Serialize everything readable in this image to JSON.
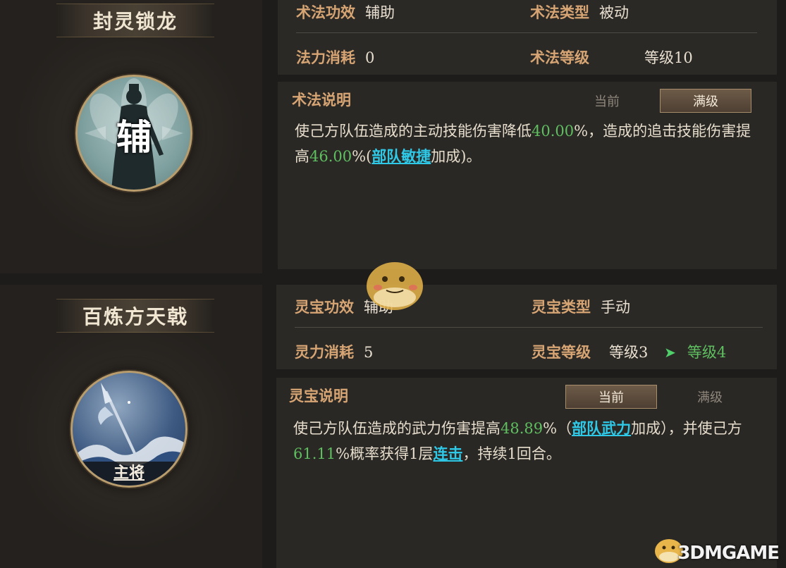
{
  "skill": {
    "name": "封灵锁龙",
    "badge": "辅",
    "effect_label": "术法功效",
    "effect_value": "辅助",
    "type_label": "术法类型",
    "type_value": "被动",
    "cost_label": "法力消耗",
    "cost_value": "0",
    "level_label": "术法等级",
    "level_value": "等级10",
    "desc_title": "术法说明",
    "tab_current": "当前",
    "tab_max": "满级",
    "active_tab": "满级",
    "desc": {
      "t1": "使己方队伍造成的主动技能伤害降低",
      "v1": "40.00",
      "t2": "%，造成的追击技能伤害提",
      "t3": "高",
      "v2": "46.00",
      "t4": "%(",
      "link": "部队敏捷",
      "t5": "加成)。"
    }
  },
  "treasure": {
    "name": "百炼方天戟",
    "role_tag": "主将",
    "effect_label": "灵宝功效",
    "effect_value": "辅助",
    "type_label": "灵宝类型",
    "type_value": "手动",
    "cost_label": "灵力消耗",
    "cost_value": "5",
    "level_label": "灵宝等级",
    "level_from": "等级3",
    "level_to": "等级4",
    "desc_title": "灵宝说明",
    "tab_current": "当前",
    "tab_max": "满级",
    "active_tab": "当前",
    "desc": {
      "t1": "使己方队伍造成的武力伤害提高",
      "v1": "48.89",
      "t2": "%（",
      "link1": "部队武力",
      "t3": "加成），并使己方",
      "v2": "61.11",
      "t4": "%概率获得1层",
      "link2": "连击",
      "t5": "，持续1回合。"
    }
  },
  "watermark": "3DMGAME",
  "colors": {
    "label": "#d7a574",
    "highlight_green": "#5fbf60",
    "link_cyan": "#2fc9e8",
    "level_up_green": "#5fbf60",
    "arrow_green": "#4fd06a"
  }
}
